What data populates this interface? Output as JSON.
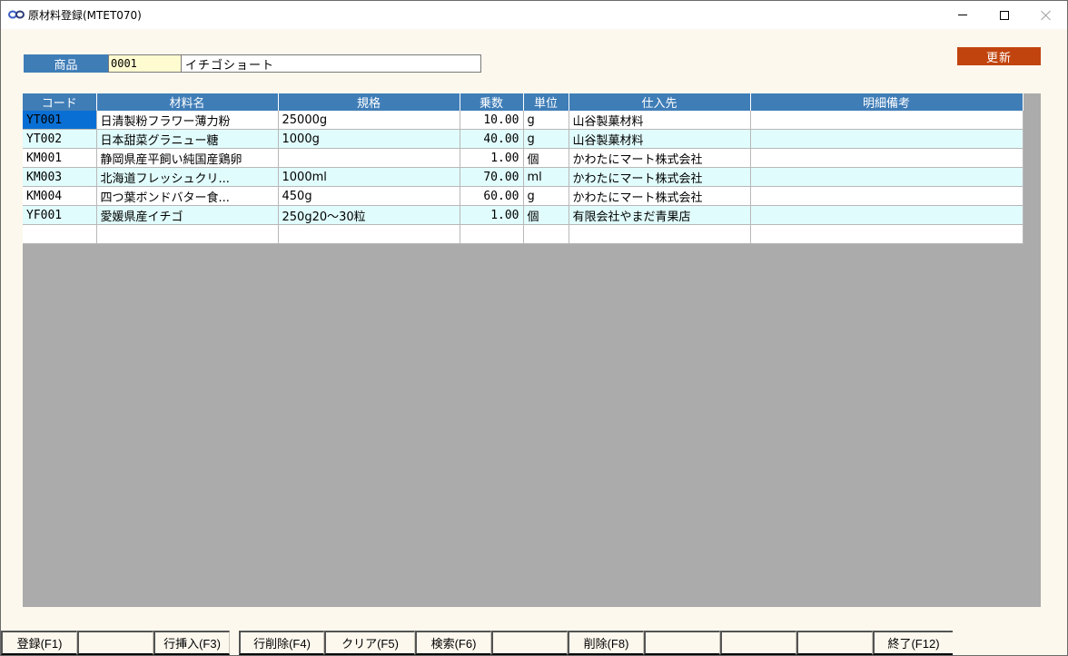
{
  "window": {
    "title": "原材料登録(MTET070)",
    "icon": "infinity-icon"
  },
  "product": {
    "label": "商品",
    "code": "0001",
    "name": "イチゴショート"
  },
  "update_button": "更新",
  "grid": {
    "columns": [
      "コード",
      "材料名",
      "規格",
      "乗数",
      "単位",
      "仕入先",
      "明細備考"
    ],
    "rows": [
      {
        "code": "YT001",
        "name": "日清製粉フラワー薄力粉",
        "spec": "25000g",
        "factor": "10.00",
        "unit": "g",
        "supplier": "山谷製菓材料",
        "note": ""
      },
      {
        "code": "YT002",
        "name": "日本甜菜グラニュー糖",
        "spec": "1000g",
        "factor": "40.00",
        "unit": "g",
        "supplier": "山谷製菓材料",
        "note": ""
      },
      {
        "code": "KM001",
        "name": "静岡県産平飼い純国産鶏卵",
        "spec": "",
        "factor": "1.00",
        "unit": "個",
        "supplier": "かわたにマート株式会社",
        "note": ""
      },
      {
        "code": "KM003",
        "name": "北海道フレッシュクリ...",
        "spec": "1000ml",
        "factor": "70.00",
        "unit": "ml",
        "supplier": "かわたにマート株式会社",
        "note": ""
      },
      {
        "code": "KM004",
        "name": "四つ葉ボンドバター食...",
        "spec": "450g",
        "factor": "60.00",
        "unit": "g",
        "supplier": "かわたにマート株式会社",
        "note": ""
      },
      {
        "code": "YF001",
        "name": "愛媛県産イチゴ",
        "spec": "250g20～30粒",
        "factor": "1.00",
        "unit": "個",
        "supplier": "有限会社やまだ青果店",
        "note": ""
      },
      {
        "code": "",
        "name": "",
        "spec": "",
        "factor": "",
        "unit": "",
        "supplier": "",
        "note": ""
      }
    ]
  },
  "function_keys": [
    "登録(F1)",
    "",
    "行挿入(F3)",
    "行削除(F4)",
    "クリア(F5)",
    "検索(F6)",
    "",
    "削除(F8)",
    "",
    "",
    "",
    "終了(F12)"
  ],
  "colors": {
    "header_blue": "#3f7db7",
    "update_button": "#c1440e",
    "selected_cell": "#0a6fd4",
    "row_alt": "#e1fcfc",
    "background": "#fdf8ee"
  }
}
